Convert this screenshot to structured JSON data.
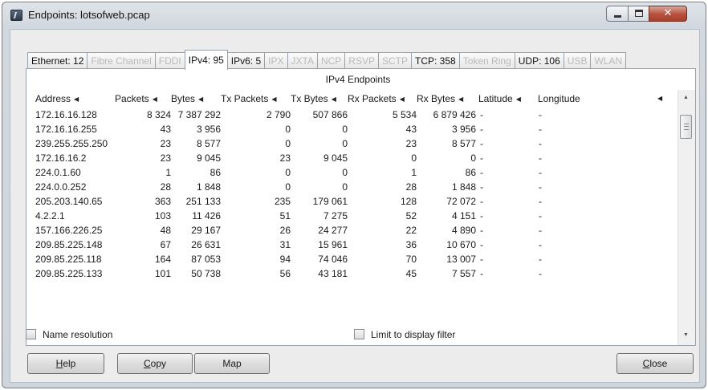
{
  "window": {
    "title": "Endpoints: lotsofweb.pcap"
  },
  "tabs": [
    {
      "label": "Ethernet: 12",
      "state": "enabled"
    },
    {
      "label": "Fibre Channel",
      "state": "disabled"
    },
    {
      "label": "FDDI",
      "state": "disabled"
    },
    {
      "label": "IPv4: 95",
      "state": "active"
    },
    {
      "label": "IPv6: 5",
      "state": "enabled"
    },
    {
      "label": "IPX",
      "state": "disabled"
    },
    {
      "label": "JXTA",
      "state": "disabled"
    },
    {
      "label": "NCP",
      "state": "disabled"
    },
    {
      "label": "RSVP",
      "state": "disabled"
    },
    {
      "label": "SCTP",
      "state": "disabled"
    },
    {
      "label": "TCP: 358",
      "state": "enabled"
    },
    {
      "label": "Token Ring",
      "state": "disabled"
    },
    {
      "label": "UDP: 106",
      "state": "enabled"
    },
    {
      "label": "USB",
      "state": "disabled"
    },
    {
      "label": "WLAN",
      "state": "disabled"
    }
  ],
  "panel": {
    "title": "IPv4 Endpoints"
  },
  "table": {
    "columns": [
      "Address",
      "Packets",
      "Bytes",
      "Tx Packets",
      "Tx Bytes",
      "Rx Packets",
      "Rx Bytes",
      "Latitude",
      "Longitude"
    ],
    "rows": [
      [
        "172.16.16.128",
        "8 324",
        "7 387 292",
        "2 790",
        "507 866",
        "5 534",
        "6 879 426",
        "-",
        "-"
      ],
      [
        "172.16.16.255",
        "43",
        "3 956",
        "0",
        "0",
        "43",
        "3 956",
        "-",
        "-"
      ],
      [
        "239.255.255.250",
        "23",
        "8 577",
        "0",
        "0",
        "23",
        "8 577",
        "-",
        "-"
      ],
      [
        "172.16.16.2",
        "23",
        "9 045",
        "23",
        "9 045",
        "0",
        "0",
        "-",
        "-"
      ],
      [
        "224.0.1.60",
        "1",
        "86",
        "0",
        "0",
        "1",
        "86",
        "-",
        "-"
      ],
      [
        "224.0.0.252",
        "28",
        "1 848",
        "0",
        "0",
        "28",
        "1 848",
        "-",
        "-"
      ],
      [
        "205.203.140.65",
        "363",
        "251 133",
        "235",
        "179 061",
        "128",
        "72 072",
        "-",
        "-"
      ],
      [
        "4.2.2.1",
        "103",
        "11 426",
        "51",
        "7 275",
        "52",
        "4 151",
        "-",
        "-"
      ],
      [
        "157.166.226.25",
        "48",
        "29 167",
        "26",
        "24 277",
        "22",
        "4 890",
        "-",
        "-"
      ],
      [
        "209.85.225.148",
        "67",
        "26 631",
        "31",
        "15 961",
        "36",
        "10 670",
        "-",
        "-"
      ],
      [
        "209.85.225.118",
        "164",
        "87 053",
        "94",
        "74 046",
        "70",
        "13 007",
        "-",
        "-"
      ],
      [
        "209.85.225.133",
        "101",
        "50 738",
        "56",
        "43 181",
        "45",
        "7 557",
        "-",
        "-"
      ]
    ]
  },
  "options": {
    "name_resolution": {
      "label": "Name resolution",
      "checked": false
    },
    "limit_filter": {
      "label": "Limit to display filter",
      "checked": false
    }
  },
  "buttons": {
    "help": {
      "accel": "H",
      "rest": "elp"
    },
    "copy": {
      "accel": "C",
      "rest": "opy"
    },
    "map": {
      "label": "Map"
    },
    "close": {
      "accel": "C",
      "rest": "lose"
    }
  },
  "colors": {
    "disabled_tab_text": "#b9b9b9",
    "close_button": "#b7503c"
  }
}
